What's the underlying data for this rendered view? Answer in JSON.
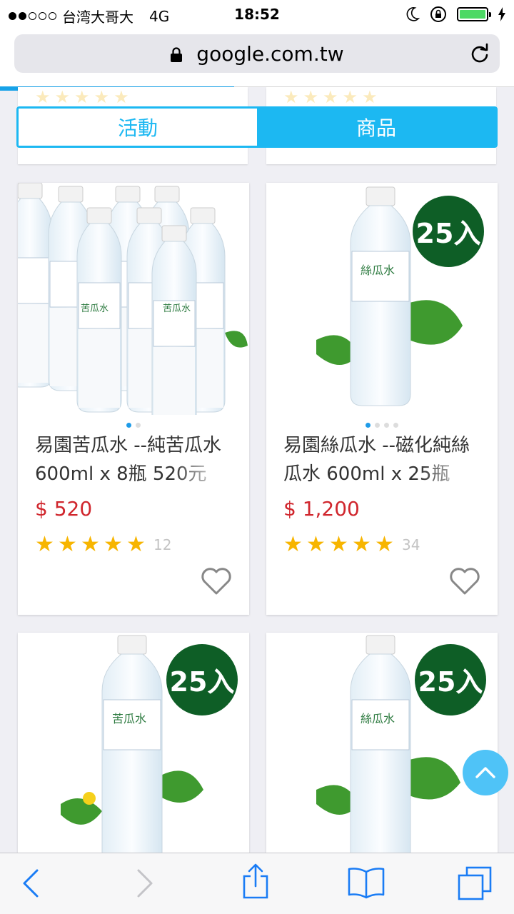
{
  "status_bar": {
    "carrier": "台湾大哥大",
    "network": "4G",
    "time": "18:52"
  },
  "browser": {
    "url": "google.com.tw",
    "progress_fraction": 0.455
  },
  "tabs": [
    {
      "label": "活動",
      "active": false
    },
    {
      "label": "商品",
      "active": true
    }
  ],
  "products": [
    {
      "title": "易園苦瓜水 --純苦瓜水 600ml x 8瓶 520元",
      "price": "$ 520",
      "rating": 5,
      "reviews": "12",
      "image_text": "苦瓜水",
      "badge": "",
      "slide_index": 0,
      "slide_count": 2
    },
    {
      "title": "易園絲瓜水 --磁化純絲瓜水 600ml x 25瓶",
      "price": "$ 1,200",
      "rating": 5,
      "reviews": "34",
      "image_text": "絲瓜水",
      "badge": "25入",
      "slide_index": 0,
      "slide_count": 4
    },
    {
      "image_text": "苦瓜水",
      "badge": "25入"
    },
    {
      "image_text": "絲瓜水",
      "badge": "25入"
    }
  ],
  "colors": {
    "accent": "#1cb8f2",
    "price": "#d0262d",
    "star": "#f7b500",
    "badge": "#0e5e26"
  },
  "icons": {
    "toolbar": [
      "back-icon",
      "forward-icon",
      "share-icon",
      "bookmarks-icon",
      "tabs-icon"
    ]
  }
}
